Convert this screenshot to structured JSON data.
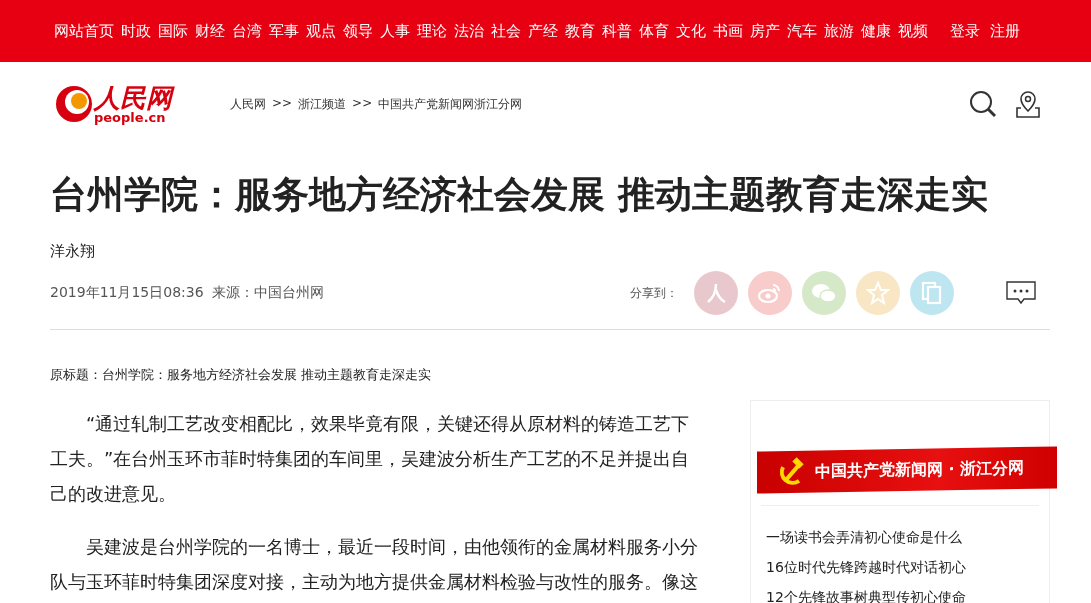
{
  "nav": {
    "items": [
      "网站首页",
      "时政",
      "国际",
      "财经",
      "台湾",
      "军事",
      "观点",
      "领导",
      "人事",
      "理论",
      "法治",
      "社会",
      "产经",
      "教育",
      "科普",
      "体育",
      "文化",
      "书画",
      "房产",
      "汽车",
      "旅游",
      "健康",
      "视频"
    ],
    "account": [
      "登录",
      "注册"
    ]
  },
  "header": {
    "logo": {
      "title": "人民网",
      "domain": "people.cn"
    },
    "breadcrumb": [
      "人民网",
      ">>",
      "浙江频道",
      ">>",
      "中国共产党新闻网浙江分网"
    ]
  },
  "article": {
    "title": "台州学院：服务地方经济社会发展 推动主题教育走深走实",
    "author": "洋永翔",
    "date": "2019年11月15日08:36",
    "source": "来源：中国台州网",
    "share": {
      "label": "分享到：",
      "buttons": [
        {
          "kind": "people",
          "color": "#e8c8cc"
        },
        {
          "kind": "weibo",
          "color": "#f9cccc"
        },
        {
          "kind": "wechat",
          "color": "#d5e8c8"
        },
        {
          "kind": "qzone",
          "color": "#f9e6c4"
        },
        {
          "kind": "copy",
          "color": "#bde6f0"
        }
      ]
    },
    "original_title": "原标题：台州学院：服务地方经济社会发展 推动主题教育走深走实",
    "paragraphs": [
      "“通过轧制工艺改变相配比，效果毕竟有限，关键还得从原材料的铸造工艺下工夫。”在台州玉环市菲时特集团的车间里，吴建波分析生产工艺的不足并提出自己的改进意见。",
      "吴建波是台州学院的一名博士，最近一段时间，由他领衔的金属材料服务小分队与玉环菲时特集团深度对接，主动为地方提供金属材料检验与改性的服务。像这"
    ]
  },
  "sidebar": {
    "banner": "中国共产党新闻网 · 浙江分网",
    "links": [
      "一场读书会弄清初心使命是什么",
      "16位时代先锋跨越时代对话初心",
      "12个先锋故事树典型传初心使命"
    ]
  }
}
